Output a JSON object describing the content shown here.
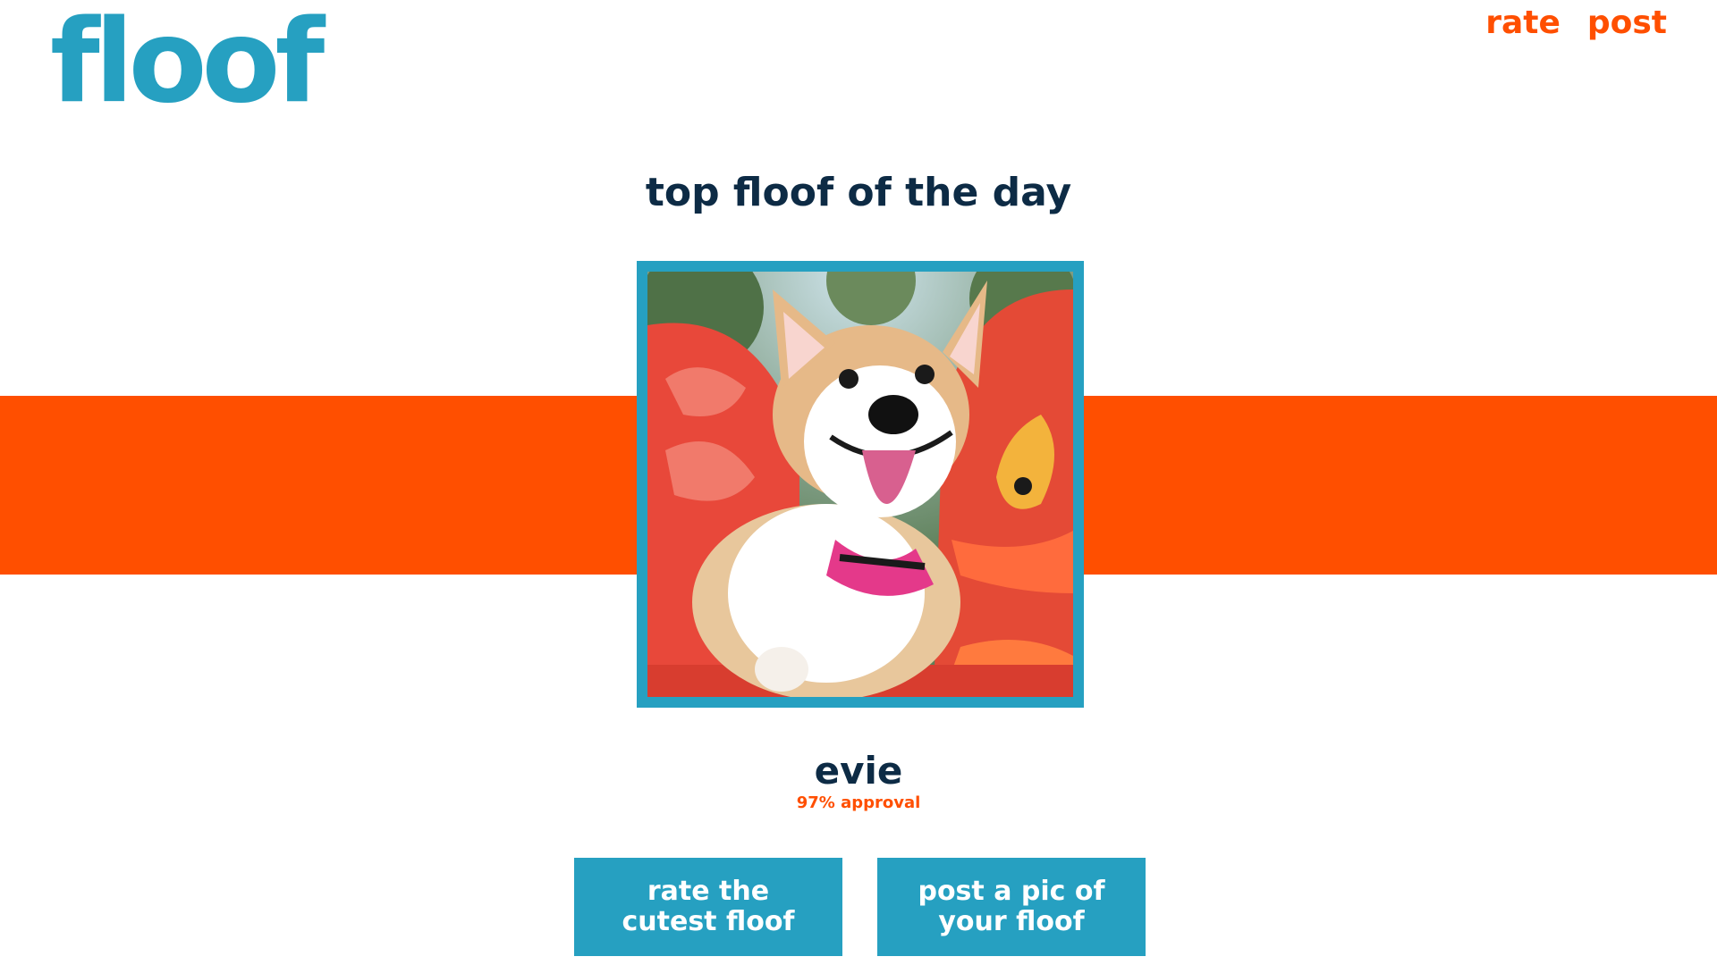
{
  "brand": {
    "name": "floof"
  },
  "nav": {
    "items": [
      {
        "label": "rate"
      },
      {
        "label": "post"
      }
    ]
  },
  "hero": {
    "title": "top floof of the day"
  },
  "featured": {
    "name": "evie",
    "approval": "97% approval"
  },
  "photo": {
    "icon": "corgi-photo"
  },
  "buttons": {
    "rate": "rate the cutest floof",
    "post": "post a pic of your floof"
  },
  "colors": {
    "brand_blue": "#26a0c1",
    "accent_orange": "#ff4f00",
    "heading_navy": "#0d2b45",
    "white": "#ffffff"
  }
}
